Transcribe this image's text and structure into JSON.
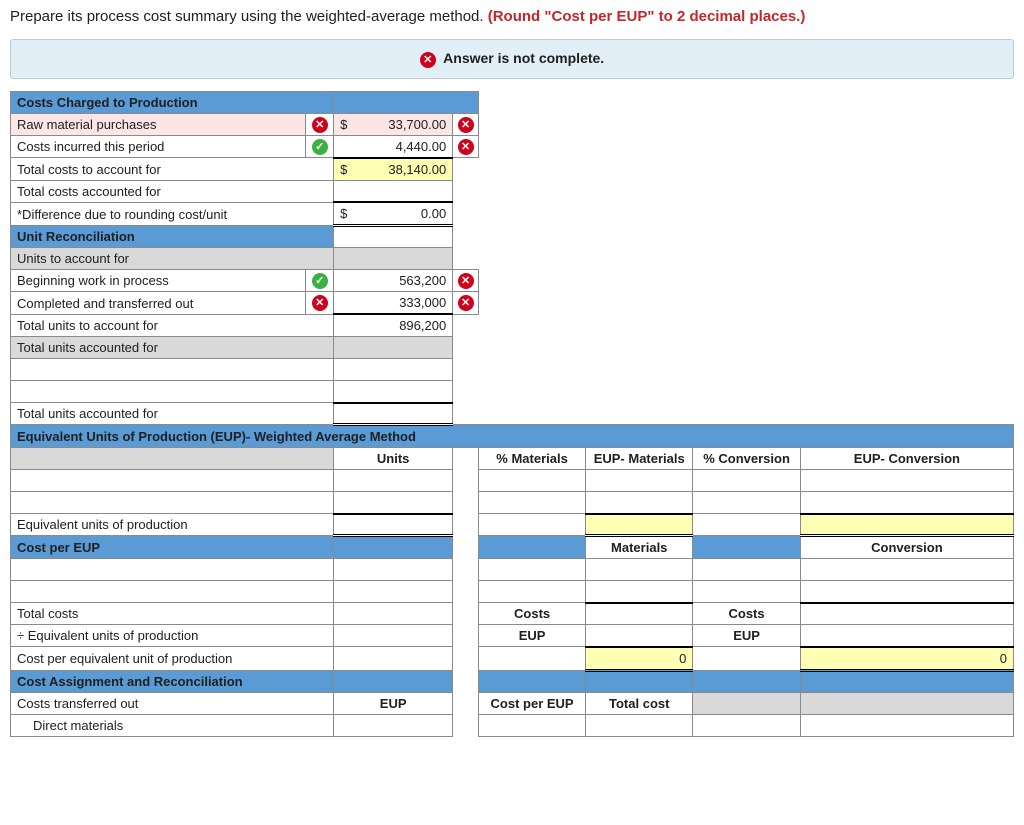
{
  "instruction": {
    "text_a": "Prepare its process cost summary using the weighted-average method. ",
    "text_b": "(Round \"Cost per EUP\" to 2 decimal places.)"
  },
  "status": {
    "message": "Answer is not complete."
  },
  "sections": {
    "costs_charged": "Costs Charged to Production",
    "unit_recon": "Unit Reconciliation",
    "eup_method": "Equivalent Units of Production (EUP)- Weighted Average Method",
    "cost_per_eup": "Cost per EUP",
    "cost_assign": "Cost Assignment and Reconciliation"
  },
  "rows": {
    "raw_mat": "Raw material purchases",
    "raw_mat_val": "33,700.00",
    "costs_period": "Costs incurred this period",
    "costs_period_val": "4,440.00",
    "total_costs_account_for": "Total costs to account for",
    "total_costs_account_for_val": "38,140.00",
    "total_costs_accounted_for": "Total costs accounted for",
    "diff_round": "*Difference due to rounding cost/unit",
    "diff_round_val": "0.00",
    "units_account_for": "Units to account for",
    "begin_wip": "Beginning work in process",
    "begin_wip_val": "563,200",
    "completed_out": "Completed and transferred out",
    "completed_out_val": "333,000",
    "total_units_account_for": "Total units to account for",
    "total_units_account_for_val": "896,200",
    "total_units_accounted_for": "Total units accounted for",
    "equiv_units_prod": "Equivalent units of production",
    "total_costs": "Total costs",
    "div_eup": "÷ Equivalent units of production",
    "cost_per_equp": "Cost per equivalent unit of production",
    "costs_transferred_out": "Costs transferred out",
    "direct_materials": "Direct materials"
  },
  "headers": {
    "units": "Units",
    "pct_materials": "% Materials",
    "eup_materials": "EUP- Materials",
    "pct_conversion": "% Conversion",
    "eup_conversion": "EUP- Conversion",
    "materials": "Materials",
    "conversion": "Conversion",
    "costs": "Costs",
    "eup": "EUP",
    "cost_per_eup": "Cost per EUP",
    "total_cost": "Total cost"
  },
  "values": {
    "zero": "0",
    "dollar": "$"
  }
}
